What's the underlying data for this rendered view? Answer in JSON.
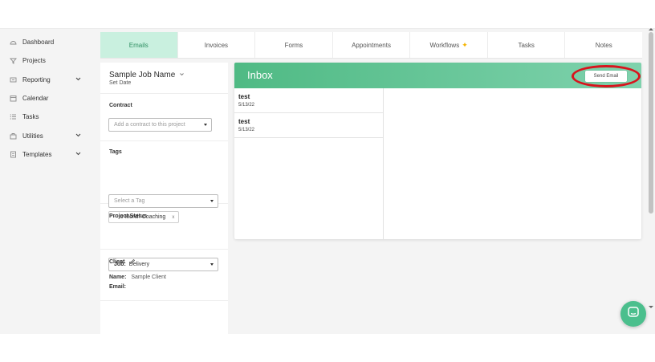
{
  "sidebar": {
    "items": [
      {
        "label": "Dashboard",
        "icon": "dashboard-icon"
      },
      {
        "label": "Projects",
        "icon": "projects-icon"
      },
      {
        "label": "Reporting",
        "icon": "reporting-icon",
        "expandable": true
      },
      {
        "label": "Calendar",
        "icon": "calendar-icon"
      },
      {
        "label": "Tasks",
        "icon": "tasks-icon"
      },
      {
        "label": "Utilities",
        "icon": "utilities-icon",
        "expandable": true
      },
      {
        "label": "Templates",
        "icon": "templates-icon",
        "expandable": true
      }
    ]
  },
  "tabs": [
    {
      "label": "Emails",
      "active": true
    },
    {
      "label": "Invoices"
    },
    {
      "label": "Forms"
    },
    {
      "label": "Appointments"
    },
    {
      "label": "Workflows",
      "icon": "sparkle-icon"
    },
    {
      "label": "Tasks"
    },
    {
      "label": "Notes"
    }
  ],
  "job": {
    "name": "Sample Job Name",
    "set_date": "Set Date"
  },
  "contract": {
    "label": "Contract",
    "placeholder": "Add a contract to this project"
  },
  "tags": {
    "label": "Tags",
    "placeholder": "Select a Tag",
    "chips": [
      {
        "label": "6 Month Coaching"
      }
    ]
  },
  "project_status": {
    "label": "Project Status",
    "key": "Job:",
    "value": "Delivery"
  },
  "client": {
    "label": "Client",
    "name_key": "Name:",
    "name_value": "Sample Client",
    "email_key": "Email:",
    "email_value": ""
  },
  "inbox": {
    "title": "Inbox",
    "send_button": "Send Email",
    "emails": [
      {
        "subject": "test",
        "date": "5/13/22"
      },
      {
        "subject": "test",
        "date": "5/13/22"
      }
    ]
  },
  "colors": {
    "accent": "#4fba84",
    "active_tab_bg": "#c9f0df",
    "highlight": "#d8141d",
    "chat_button": "#4bbf8d"
  }
}
